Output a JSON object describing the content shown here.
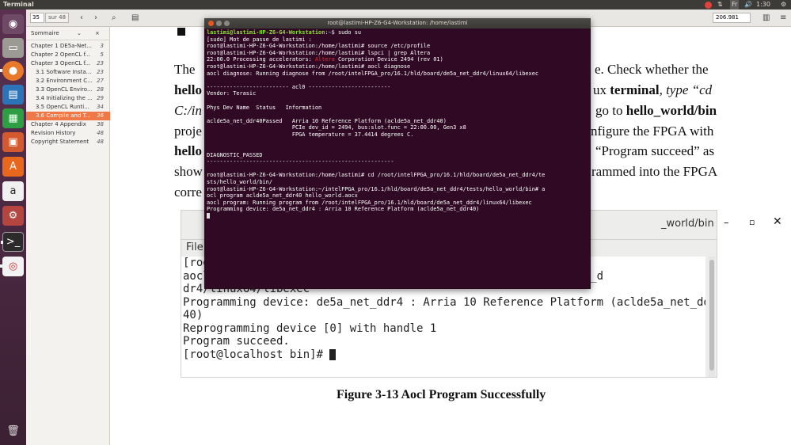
{
  "system": {
    "app_title": "Terminal",
    "keyboard_layout": "Fr",
    "time": "1:30"
  },
  "launcher": {
    "items": [
      "ubuntu-dash",
      "files",
      "firefox",
      "libreoffice-writer",
      "libreoffice-calc",
      "libreoffice-impress",
      "ubuntu-software",
      "amazon",
      "system-settings",
      "terminal",
      "screenshot-app",
      "trash"
    ]
  },
  "toolbar": {
    "page_number": "35",
    "page_of": "sur 48",
    "zoom": "206.981"
  },
  "sidebar": {
    "mode_label": "Sommaire",
    "items": [
      {
        "label": "Chapter 1  DE5a-Net...",
        "page": "3"
      },
      {
        "label": "Chapter 2  OpenCL f...",
        "page": "5"
      },
      {
        "label": "Chapter 3  OpenCL f...",
        "page": "23"
      },
      {
        "label": "3.1 Software Instal...",
        "page": "23"
      },
      {
        "label": "3.2 Environment C...",
        "page": "27"
      },
      {
        "label": "3.3 OpenCL Enviro...",
        "page": "28"
      },
      {
        "label": "3.4 Initializing the ...",
        "page": "29"
      },
      {
        "label": "3.5 OpenCL Runti...",
        "page": "34"
      },
      {
        "label": "3.6 Compile and Te...",
        "page": "36"
      },
      {
        "label": "Chapter 4  Appendix",
        "page": "38"
      },
      {
        "label": "Revision History",
        "page": "48"
      },
      {
        "label": "Copyright Statement",
        "page": "48"
      }
    ]
  },
  "document": {
    "lines": [
      {
        "left": "The",
        "right": "e. Check whether the"
      },
      {
        "left": "hello",
        "right_plain": "ux ",
        "right_bold": "terminal",
        "right_tail": ", type “cd"
      },
      {
        "left": "C:/in",
        "right_plain": "go to ",
        "right_bold": "hello_world/bin"
      },
      {
        "left": "proje",
        "right": "nfigure the FPGA with"
      },
      {
        "left": "hello",
        "right": "“Program succeed” as"
      },
      {
        "left": "show",
        "right": "rammed into the FPGA"
      },
      {
        "left": "corre",
        "right": ""
      }
    ],
    "figure": {
      "window_title": "_world/bin",
      "menu_label": "File",
      "terminal_lines": [
        "[root",
        "aocl                                          /board/de5a_net_d",
        "dr4/linux64/libexec",
        "Programming device: de5a_net_ddr4 : Arria 10 Reference Platform (aclde5a_net_ddr",
        "40)",
        "Reprogramming device [0] with handle 1",
        "Program succeed.",
        "[root@localhost bin]# "
      ],
      "caption": "Figure 3-13 Aocl Program Successfully"
    }
  },
  "terminal": {
    "title": "root@lastimi-HP-Z6-G4-Workstation: /home/lastimi",
    "prompt_user": "lastimi@lastimi-HP-Z6-G4-Workstation",
    "prompt_path": "~",
    "first_command": "$ sudo su",
    "lines": [
      "[sudo] Mot de passe de lastimi :",
      "root@lastimi-HP-Z6-G4-Workstation:/home/lastimi# source /etc/profile",
      "root@lastimi-HP-Z6-G4-Workstation:/home/lastimi# lspci | grep Altera"
    ],
    "lspci_prefix": "22:00.0 Processing accelerators: ",
    "lspci_vendor": "Altera",
    "lspci_suffix": " Corporation Device 2494 (rev 01)",
    "lines2": [
      "root@lastimi-HP-Z6-G4-Workstation:/home/lastimi# aocl diagnose",
      "aocl diagnose: Running diagnose from /root/intelFPGA_pro/16.1/hld/board/de5a_net_ddr4/linux64/libexec",
      "",
      "------------------------- acl0 -------------------------",
      "Vendor: Terasic",
      "",
      "Phys Dev Name  Status   Information",
      "",
      "aclde5a_net_ddr40Passed   Arria 10 Reference Platform (aclde5a_net_ddr40)",
      "                          PCIe dev_id = 2494, bus:slot.func = 22:00.00, Gen3 x8",
      "                          FPGA temperature = 37.4414 degrees C.",
      "",
      "",
      "DIAGNOSTIC_PASSED",
      "---------------------------------------------------------",
      "",
      "root@lastimi-HP-Z6-G4-Workstation:/home/lastimi# cd /root/intelFPGA_pro/16.1/hld/board/de5a_net_ddr4/te",
      "sts/hello_world/bin/",
      "root@lastimi-HP-Z6-G4-Workstation:~/intelFPGA_pro/16.1/hld/board/de5a_net_ddr4/tests/hello_world/bin# a",
      "ocl program aclde5a_net_ddr40 hello_world.aocx",
      "aocl program: Running program from /root/intelFPGA_pro/16.1/hld/board/de5a_net_ddr4/linux64/libexec",
      "Programming device: de5a_net_ddr4 : Arria 10 Reference Platform (aclde5a_net_ddr40)"
    ]
  }
}
